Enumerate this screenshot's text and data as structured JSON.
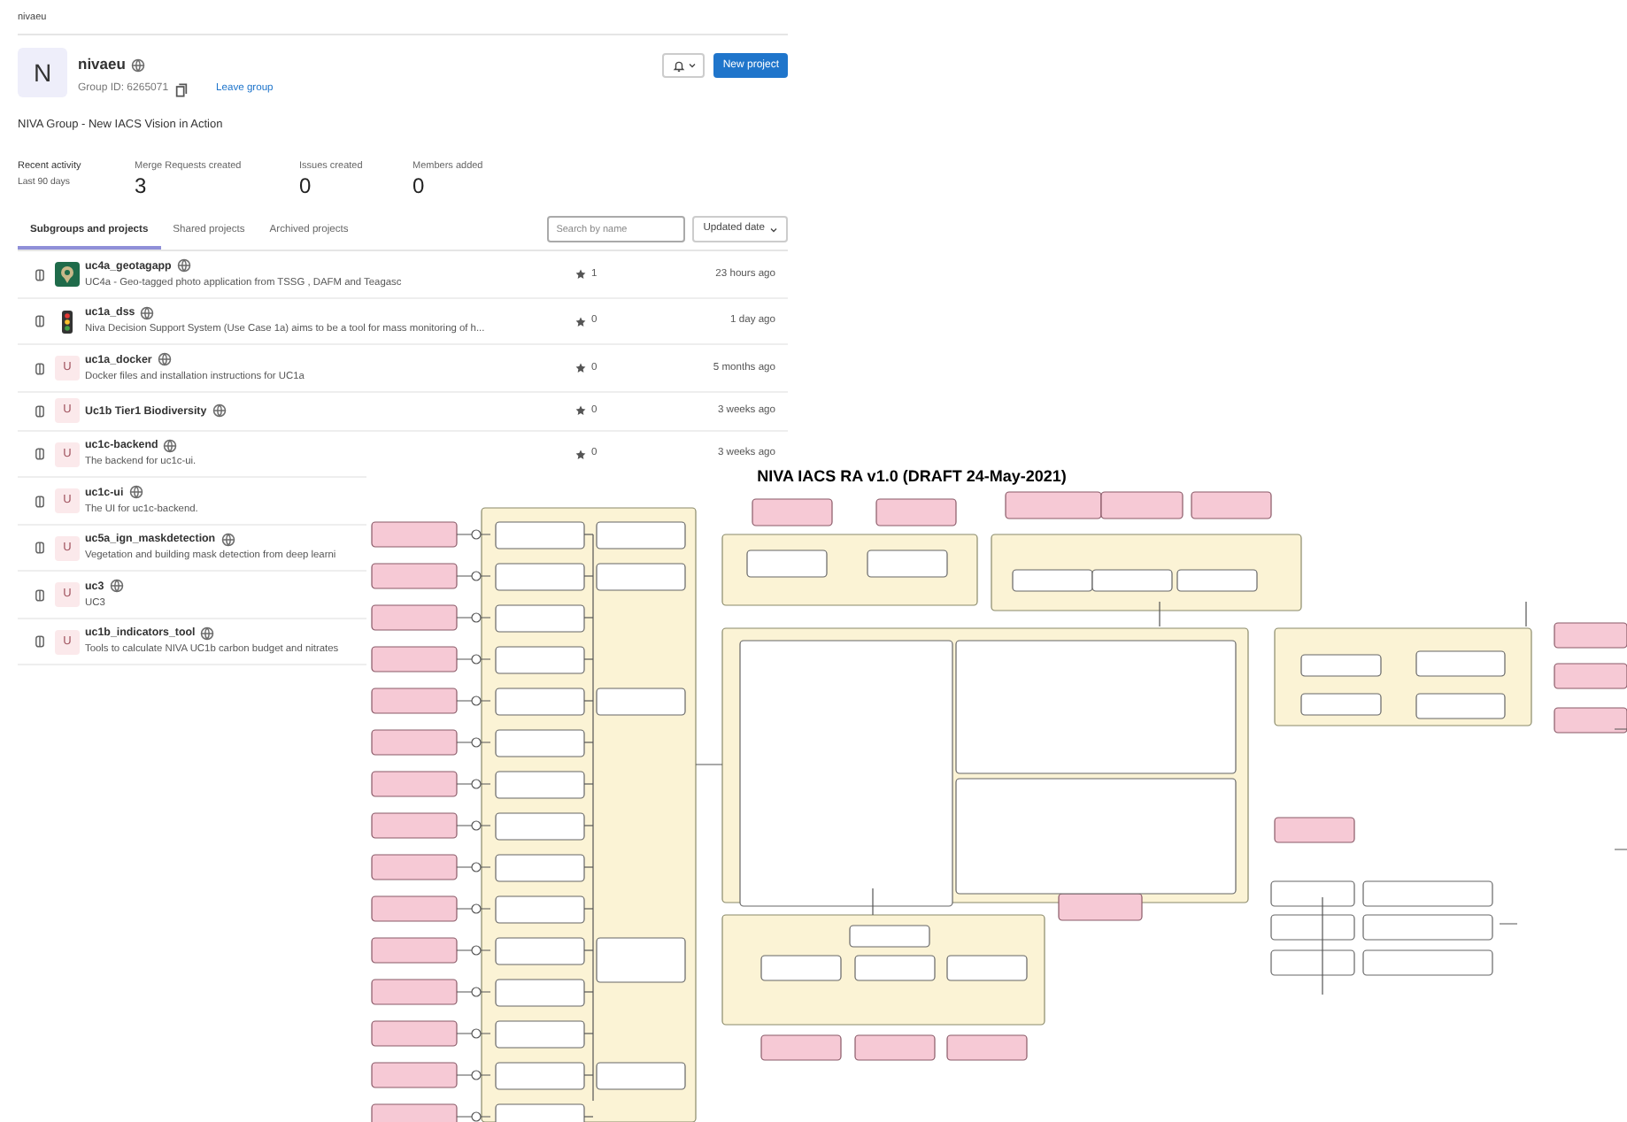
{
  "breadcrumb": "nivaeu",
  "group": {
    "avatar_letter": "N",
    "name": "nivaeu",
    "group_id": "Group ID: 6265071",
    "leave_link": "Leave group",
    "new_project": "New project"
  },
  "description": "NIVA Group - New IACS Vision in Action",
  "activity": {
    "label": "Recent activity",
    "period": "Last 90 days",
    "stats": [
      {
        "label": "Merge Requests created",
        "value": "3"
      },
      {
        "label": "Issues created",
        "value": "0"
      },
      {
        "label": "Members added",
        "value": "0"
      }
    ]
  },
  "tabs": [
    {
      "label": "Subgroups and projects",
      "selected": true
    },
    {
      "label": "Shared projects",
      "selected": false
    },
    {
      "label": "Archived projects",
      "selected": false
    }
  ],
  "search": {
    "placeholder": "Search by name"
  },
  "sort": {
    "label": "Updated date"
  },
  "projects": [
    {
      "kind": "pin-logo",
      "name": "uc4a_geotagapp",
      "description": "UC4a - Geo-tagged photo application from TSSG , DAFM and Teagasc",
      "stars": "1",
      "updated": "23 hours ago"
    },
    {
      "kind": "traffic-light-logo",
      "name": "uc1a_dss",
      "description": "Niva Decision Support System (Use Case 1a) aims to be a tool for mass monitoring of h...",
      "stars": "0",
      "updated": "1 day ago"
    },
    {
      "kind": "letter",
      "letter": "U",
      "name": "uc1a_docker",
      "description": "Docker files and installation instructions for UC1a",
      "stars": "0",
      "updated": "5 months ago"
    },
    {
      "kind": "letter",
      "letter": "U",
      "name": "Uc1b Tier1 Biodiversity",
      "stars": "0",
      "updated": "3 weeks ago"
    },
    {
      "kind": "letter",
      "letter": "U",
      "name": "uc1c-backend",
      "description": "The backend for uc1c-ui.",
      "stars": "0",
      "updated": "3 weeks ago"
    },
    {
      "kind": "letter",
      "letter": "U",
      "name": "uc1c-ui",
      "description": "The UI for uc1c-backend."
    },
    {
      "kind": "letter",
      "letter": "U",
      "name": "uc5a_ign_maskdetection",
      "description": "Vegetation and building mask detection from deep learni"
    },
    {
      "kind": "letter",
      "letter": "U",
      "name": "uc3",
      "description": "UC3"
    },
    {
      "kind": "letter",
      "letter": "U",
      "name": "uc1b_indicators_tool",
      "description": "Tools to calculate NIVA UC1b carbon budget and nitrates"
    }
  ],
  "diagram": {
    "title": "NIVA IACS RA v1.0 (DRAFT 24-May-2021)"
  }
}
